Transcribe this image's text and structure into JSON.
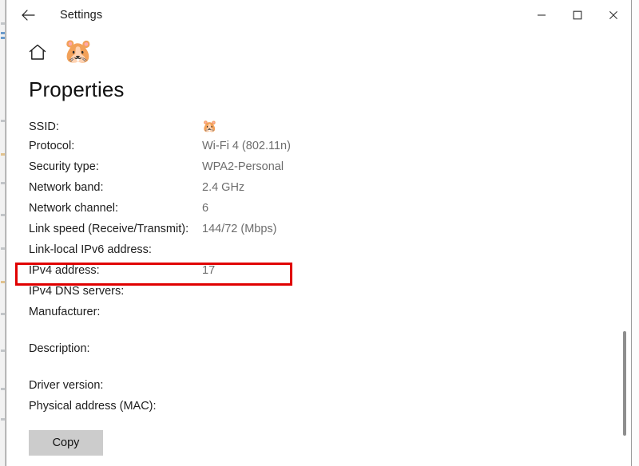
{
  "window": {
    "title": "Settings",
    "back_icon": "back-arrow-icon",
    "minimize_label": "—",
    "maximize_label": "☐",
    "close_label": "✕"
  },
  "header": {
    "home_icon": "home-icon",
    "network_emoji": "🐹"
  },
  "page": {
    "title": "Properties"
  },
  "properties": [
    {
      "label": "SSID:",
      "value": "🐹",
      "is_emoji": true
    },
    {
      "label": "Protocol:",
      "value": "Wi-Fi 4 (802.11n)"
    },
    {
      "label": "Security type:",
      "value": "WPA2-Personal"
    },
    {
      "label": "Network band:",
      "value": "2.4 GHz"
    },
    {
      "label": "Network channel:",
      "value": "6"
    },
    {
      "label": "Link speed (Receive/Transmit):",
      "value": "144/72 (Mbps)"
    },
    {
      "label": "Link-local IPv6 address:",
      "value": ""
    },
    {
      "label": "IPv4 address:",
      "value": "17",
      "highlighted": true
    },
    {
      "label": "IPv4 DNS servers:",
      "value": ""
    },
    {
      "label": "Manufacturer:",
      "value": "",
      "gap_after": true
    },
    {
      "label": "Description:",
      "value": "",
      "gap_after": true
    },
    {
      "label": "Driver version:",
      "value": ""
    },
    {
      "label": "Physical address (MAC):",
      "value": ""
    }
  ],
  "actions": {
    "copy_label": "Copy"
  },
  "annotation": {
    "highlight_color": "#e00000",
    "highlighted_row_label": "IPv4 address:"
  },
  "colors": {
    "label_text": "#1d1d1d",
    "value_text": "#6d6d6d",
    "window_background": "#ffffff",
    "button_background": "#cccccc",
    "window_border": "#9b9b9b"
  }
}
